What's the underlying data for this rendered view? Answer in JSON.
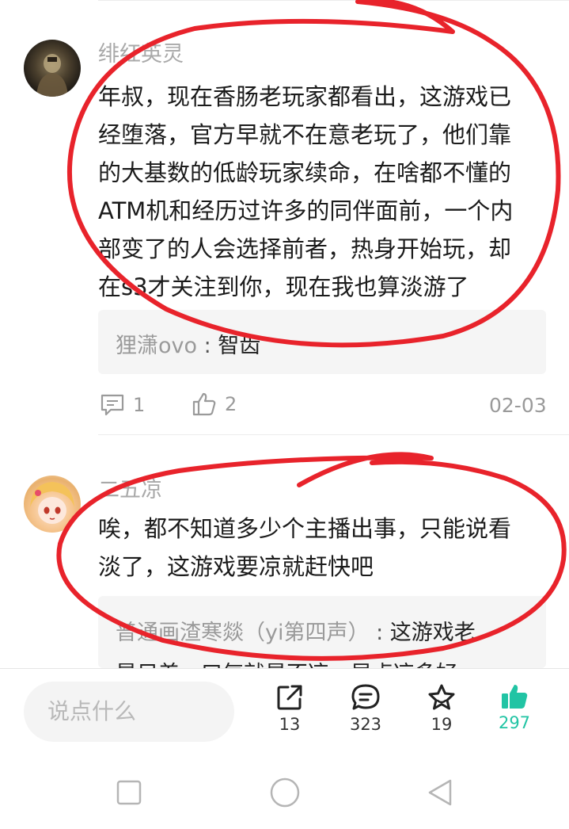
{
  "comments": [
    {
      "username": "绯红英灵",
      "body_lines": [
        "年叔，现在香肠老玩家都看出，这游戏已",
        "经堕落，官方早就不在意老玩了，他们靠",
        "的大基数的低龄玩家续命，在啥都不懂的",
        "ATM机和经历过许多的同伴面前，一个内",
        "部变了的人会选择前者，热身开始玩，却",
        "在s3才关注到你，现在我也算淡游了"
      ],
      "reply": {
        "author": "狸潇ovo",
        "separator": " : ",
        "text": "智齿"
      },
      "reply_count": "1",
      "like_count": "2",
      "date": "02-03"
    },
    {
      "username": "二五凉",
      "body_lines": [
        "唉，都不知道多少个主播出事，只能说看",
        "淡了，这游戏要凉就赶快吧"
      ],
      "reply": {
        "author": "普通画渣寒燚（yi第四声）",
        "separator": " : ",
        "text": "这游戏老",
        "text_line2": "是只差一口气就是不凉，早点凉多好"
      }
    }
  ],
  "bottom_bar": {
    "input_placeholder": "说点什么",
    "share_count": "13",
    "comment_count": "323",
    "favorite_count": "19",
    "like_count": "297",
    "like_color": "#21c4a4"
  },
  "icons": [
    "share-icon",
    "comment-bubble-icon",
    "star-icon",
    "thumbs-up-icon",
    "nav-recent-icon",
    "nav-home-icon",
    "nav-back-icon"
  ],
  "annotation_color": "#e8232b"
}
